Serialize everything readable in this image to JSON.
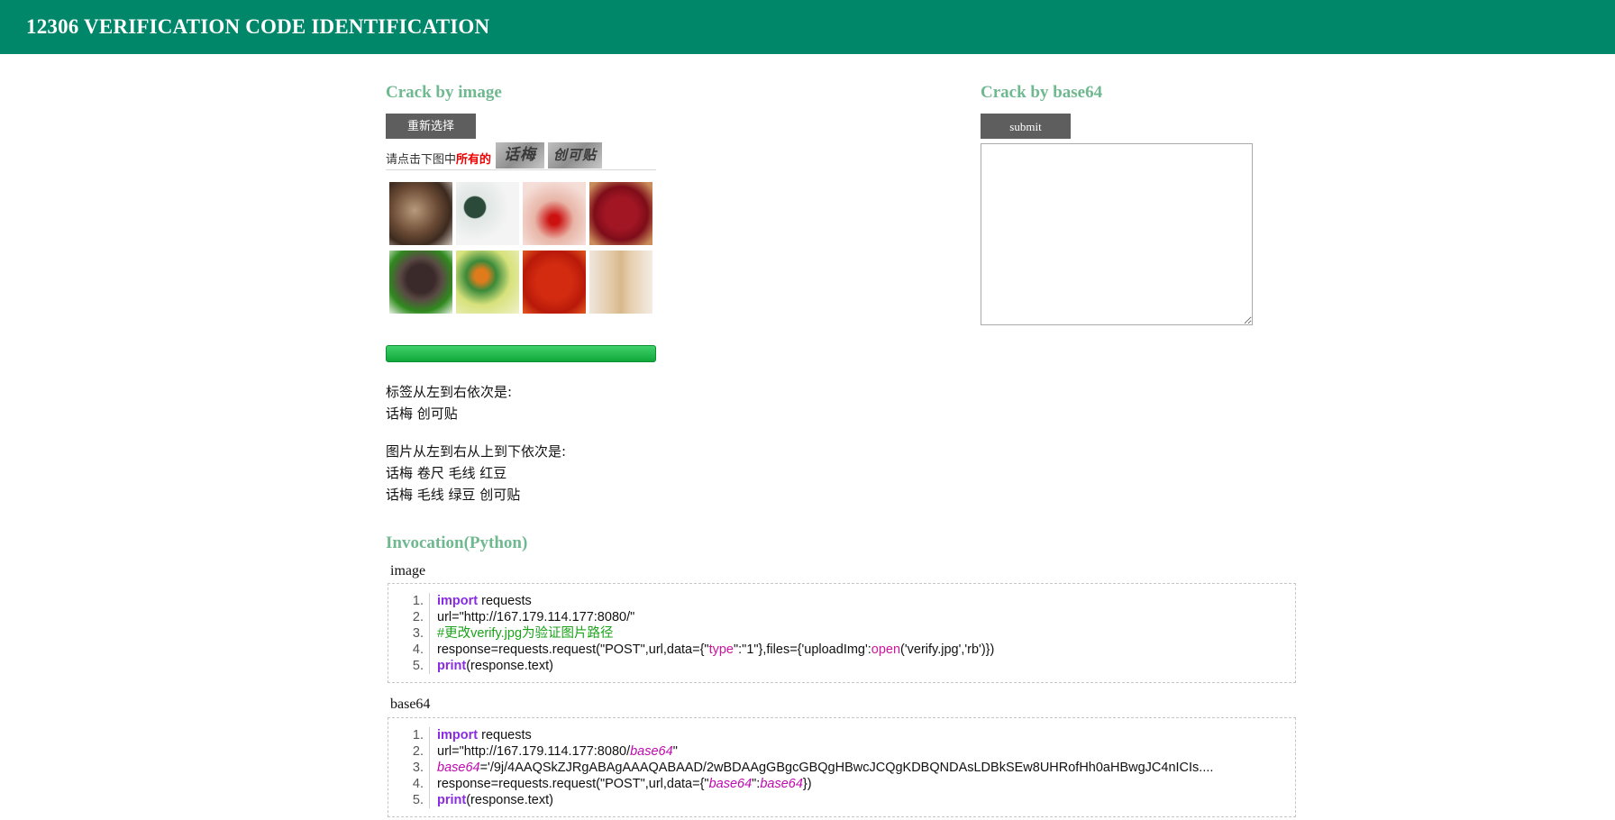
{
  "header": {
    "title": "12306 VERIFICATION CODE IDENTIFICATION"
  },
  "crack_image": {
    "title": "Crack by image",
    "reselect_label": "重新选择",
    "captcha": {
      "prompt_plain": "请点击下图中",
      "prompt_red": "所有的",
      "words": [
        "话梅",
        "创可贴"
      ]
    },
    "progress_percent": 100,
    "labels_heading": "标签从左到右依次是:",
    "labels_value": "话梅 创可贴",
    "images_heading": "图片从左到右从上到下依次是:",
    "images_row1": "话梅 卷尺 毛线 红豆",
    "images_row2": "话梅 毛线 绿豆 创可贴"
  },
  "crack_base64": {
    "title": "Crack by base64",
    "submit_label": "submit",
    "textarea_value": ""
  },
  "invocation": {
    "title": "Invocation(Python)",
    "image_label": "image",
    "base64_label": "base64",
    "image_code": {
      "l1_kw": "import",
      "l1_rest": " requests",
      "l2": "url=\"http://167.179.114.177:8080/\"",
      "l3": "#更改verify.jpg为验证图片路径",
      "l4_a": "response=requests.request(\"POST\",url,data={\"",
      "l4_type": "type",
      "l4_b": "\":\"1\"},files={'uploadImg':",
      "l4_open": "open",
      "l4_c": "('verify.jpg','rb')})",
      "l5_kw": "print",
      "l5_rest": "(response.text)"
    },
    "base64_code": {
      "l1_kw": "import",
      "l1_rest": " requests",
      "l2_a": "url=\"http://167.179.114.177:8080/",
      "l2_it": "base64",
      "l2_b": "\"",
      "l3_it": "base64",
      "l3_rest": "='/9j/4AAQSkZJRgABAgAAAQABAAD/2wBDAAgGBgcGBQgHBwcJCQgKDBQNDAsLDBkSEw8UHRofHh0aHBwgJC4nICIs....",
      "l4_a": "response=requests.request(\"POST\",url,data={\"",
      "l4_it1": "base64",
      "l4_b": "\":",
      "l4_it2": "base64",
      "l4_c": "})",
      "l5_kw": "print",
      "l5_rest": "(response.text)"
    },
    "line_numbers": [
      "1.",
      "2.",
      "3.",
      "4.",
      "5."
    ]
  }
}
